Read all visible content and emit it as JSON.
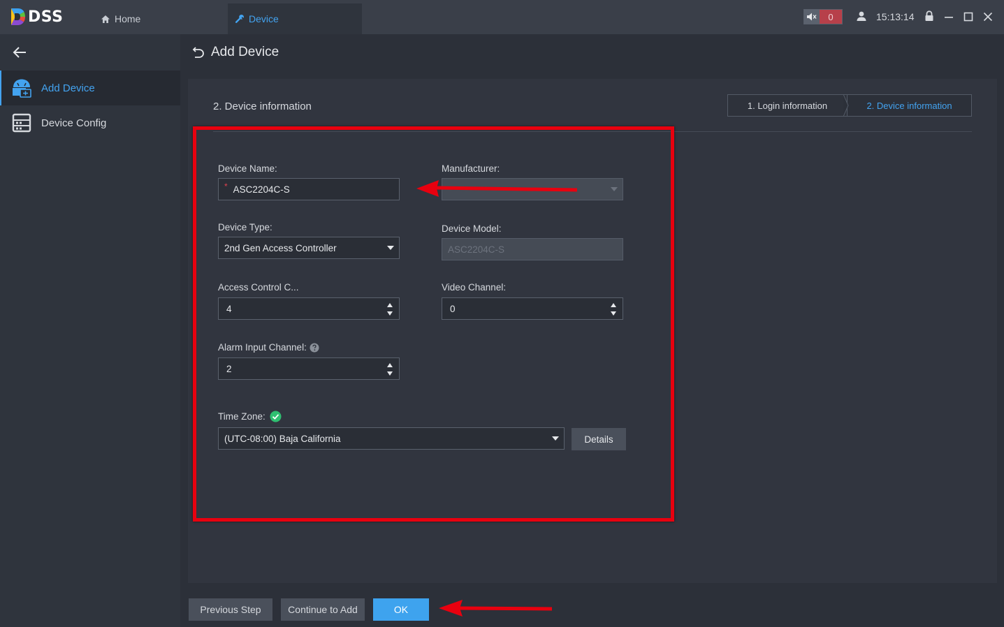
{
  "app": {
    "logo_text": "DSS"
  },
  "top_tabs": [
    {
      "label": "Home"
    },
    {
      "label": "Device"
    }
  ],
  "status": {
    "alarm_count": "0",
    "time": "15:13:14"
  },
  "sidebar": {
    "items": [
      {
        "label": "Add Device"
      },
      {
        "label": "Device Config"
      }
    ]
  },
  "page": {
    "title": "Add Device"
  },
  "section": {
    "title": "2. Device information"
  },
  "steps": [
    {
      "label": "1. Login information"
    },
    {
      "label": "2. Device information"
    }
  ],
  "form": {
    "device_name": {
      "label": "Device Name:",
      "value": "ASC2204C-S"
    },
    "manufacturer": {
      "label": "Manufacturer:",
      "value": ""
    },
    "device_type": {
      "label": "Device Type:",
      "value": "2nd Gen Access Controller"
    },
    "device_model": {
      "label": "Device Model:",
      "value": "ASC2204C-S"
    },
    "access_control_channel": {
      "label": "Access Control C...",
      "value": "4"
    },
    "video_channel": {
      "label": "Video Channel:",
      "value": "0"
    },
    "alarm_input_channel": {
      "label": "Alarm Input Channel:",
      "value": "2"
    },
    "time_zone": {
      "label": "Time Zone:",
      "value": "(UTC-08:00) Baja California"
    },
    "details_label": "Details"
  },
  "footer": {
    "prev_label": "Previous Step",
    "continue_label": "Continue to Add",
    "ok_label": "OK"
  },
  "colors": {
    "accent": "#43a3f0",
    "ok_button": "#3ea3ee",
    "annotation": "#e8000f",
    "alarm": "#b7404a",
    "valid": "#2fbf71"
  }
}
